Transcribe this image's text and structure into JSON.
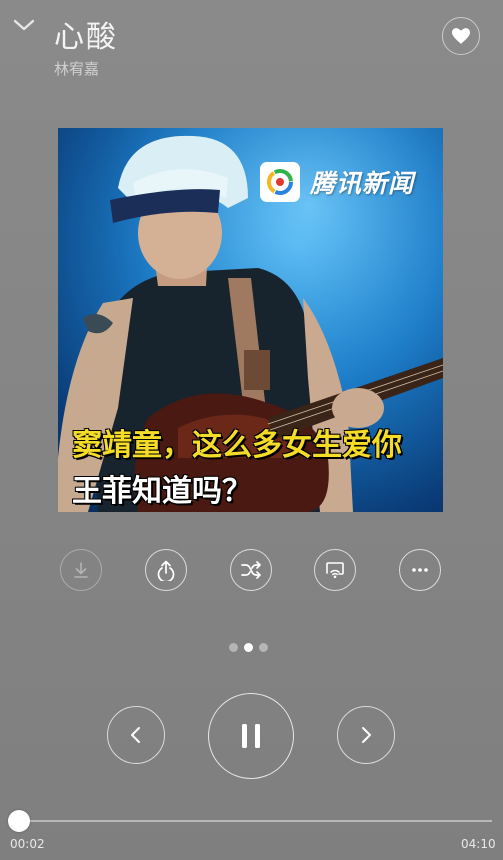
{
  "song": {
    "title": "心酸",
    "artist": "林宥嘉",
    "favorited": false
  },
  "cover": {
    "brand": "腾讯新闻",
    "headline_line1": "窦靖童，这么多女生爱你",
    "headline_line2": "王菲知道吗？"
  },
  "actions": [
    {
      "name": "download",
      "icon": "download-icon",
      "enabled": false
    },
    {
      "name": "share",
      "icon": "share-icon",
      "enabled": true
    },
    {
      "name": "shuffle",
      "icon": "shuffle-icon",
      "enabled": true
    },
    {
      "name": "cast",
      "icon": "cast-icon",
      "enabled": true
    },
    {
      "name": "more",
      "icon": "more-icon",
      "enabled": true
    }
  ],
  "pager": {
    "count": 3,
    "active_index": 1
  },
  "playback": {
    "state": "playing",
    "current_time": "00:02",
    "total_time": "04:10",
    "progress": 0.008
  },
  "colors": {
    "background": "#868686",
    "headline_yellow": "#f5dd27",
    "foreground": "#ffffff"
  }
}
